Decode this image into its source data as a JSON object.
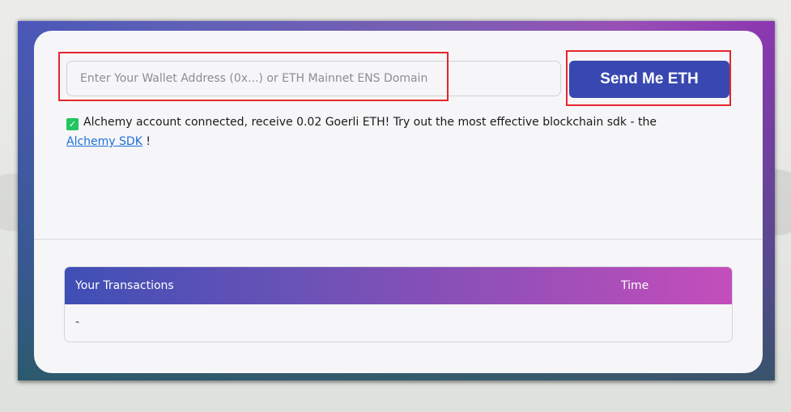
{
  "faucet": {
    "input_placeholder": "Enter Your Wallet Address (0x...) or ETH Mainnet ENS Domain",
    "input_value": "",
    "send_button_label": "Send Me ETH"
  },
  "status": {
    "check_glyph": "✓",
    "message": "Alchemy account connected, receive 0.02 Goerli ETH! Try out the most effective blockchain sdk - the",
    "link_text": "Alchemy SDK",
    "suffix": "!"
  },
  "transactions": {
    "columns": [
      "Your Transactions",
      "Time"
    ],
    "rows": [
      {
        "tx": "-",
        "time": ""
      }
    ]
  },
  "colors": {
    "button": "#3848b0",
    "highlight": "#e5252e",
    "check": "#22c55e",
    "link": "#1d6fd8"
  }
}
